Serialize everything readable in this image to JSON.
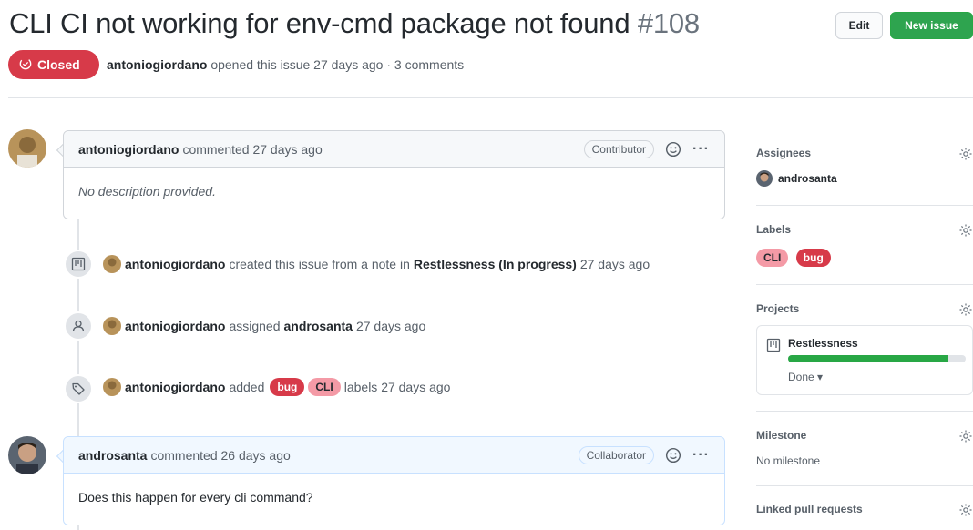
{
  "issue": {
    "title": "CLI CI not working for env-cmd package not found",
    "number": "#108",
    "state": "Closed",
    "author": "antoniogiordano",
    "meta_rest": "opened this issue 27 days ago · 3 comments"
  },
  "buttons": {
    "edit": "Edit",
    "new_issue": "New issue"
  },
  "timeline": {
    "comment1": {
      "author": "antoniogiordano",
      "action": "commented 27 days ago",
      "role": "Contributor",
      "body": "No description provided."
    },
    "event_created": {
      "actor": "antoniogiordano",
      "text1": "created this issue from a note in",
      "project": "Restlessness (In progress)",
      "time": "27 days ago"
    },
    "event_assigned": {
      "actor": "antoniogiordano",
      "text1": "assigned",
      "assignee": "androsanta",
      "time": "27 days ago"
    },
    "event_labels": {
      "actor": "antoniogiordano",
      "text1": "added",
      "labels": [
        "bug",
        "CLI"
      ],
      "text2": "labels 27 days ago"
    },
    "comment2": {
      "author": "androsanta",
      "action": "commented 26 days ago",
      "role": "Collaborator",
      "body": "Does this happen for every cli command?"
    }
  },
  "sidebar": {
    "assignees": {
      "title": "Assignees",
      "user": "androsanta"
    },
    "labels": {
      "title": "Labels",
      "items": [
        "CLI",
        "bug"
      ]
    },
    "projects": {
      "title": "Projects",
      "name": "Restlessness",
      "column": "Done ▾",
      "progress_percent": 90
    },
    "milestone": {
      "title": "Milestone",
      "value": "No milestone"
    },
    "linked_prs": {
      "title": "Linked pull requests"
    }
  },
  "colors": {
    "closed_red": "#d73a49",
    "green": "#2ea44f",
    "label_bug": "#d73a49",
    "label_cli": "#f49aa6",
    "progress": "#28a745"
  }
}
